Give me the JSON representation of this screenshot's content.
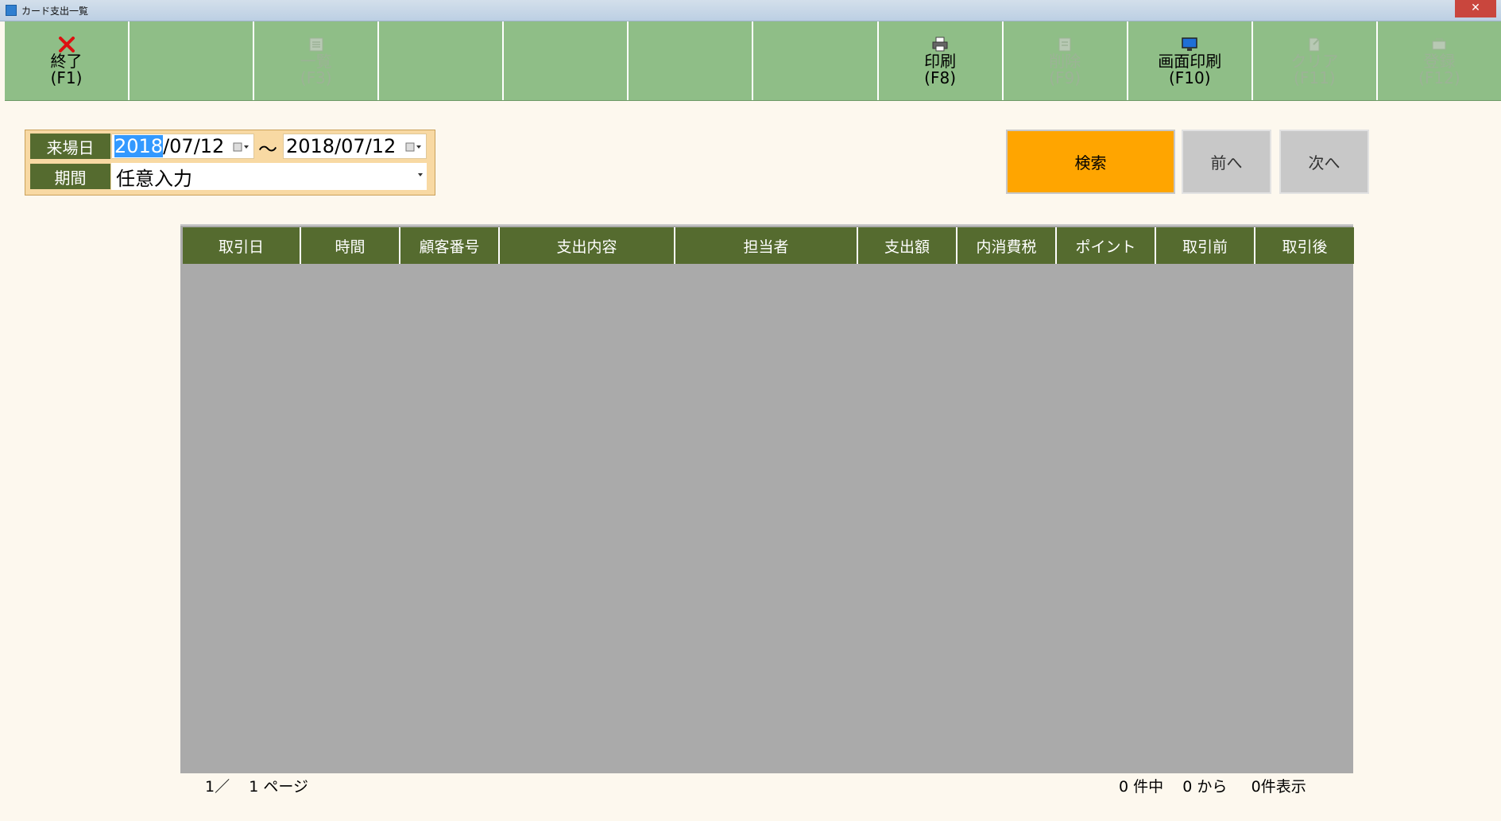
{
  "window": {
    "title": "カード支出一覧"
  },
  "toolbar": {
    "buttons": [
      {
        "label": "終了",
        "key": "(F1)",
        "icon": "close-x-icon",
        "enabled": true
      },
      {
        "label": "",
        "key": "",
        "icon": "",
        "enabled": false
      },
      {
        "label": "一覧",
        "key": "(F3)",
        "icon": "list-icon",
        "enabled": false
      },
      {
        "label": "",
        "key": "",
        "icon": "",
        "enabled": false
      },
      {
        "label": "",
        "key": "",
        "icon": "",
        "enabled": false
      },
      {
        "label": "",
        "key": "",
        "icon": "",
        "enabled": false
      },
      {
        "label": "",
        "key": "",
        "icon": "",
        "enabled": false
      },
      {
        "label": "印刷",
        "key": "(F8)",
        "icon": "printer-icon",
        "enabled": true
      },
      {
        "label": "削除",
        "key": "(F9)",
        "icon": "delete-icon",
        "enabled": false
      },
      {
        "label": "画面印刷",
        "key": "(F10)",
        "icon": "monitor-icon",
        "enabled": true
      },
      {
        "label": "クリア",
        "key": "(F11)",
        "icon": "clear-icon",
        "enabled": false
      },
      {
        "label": "登録",
        "key": "(F12)",
        "icon": "register-icon",
        "enabled": false
      }
    ]
  },
  "filter": {
    "visit_date_label": "来場日",
    "date_from_selected": "2018",
    "date_from_rest": "/07/12",
    "range_separator": "～",
    "date_to": "2018/07/12",
    "period_label": "期間",
    "period_value": "任意入力"
  },
  "actions": {
    "search": "検索",
    "prev": "前へ",
    "next": "次へ"
  },
  "grid": {
    "columns": [
      "取引日",
      "時間",
      "顧客番号",
      "支出内容",
      "担当者",
      "支出額",
      "内消費税",
      "ポイント",
      "取引前",
      "取引後"
    ],
    "rows": []
  },
  "footer": {
    "page_info": "1／    1 ページ",
    "count_info": "0 件中    0 から     0件表示"
  },
  "colors": {
    "toolbar_bg": "#8fbe87",
    "header_green": "#556b2f",
    "search_orange": "#ffa500",
    "grid_bg": "#aaaaaa",
    "page_bg": "#fdf8ee"
  }
}
